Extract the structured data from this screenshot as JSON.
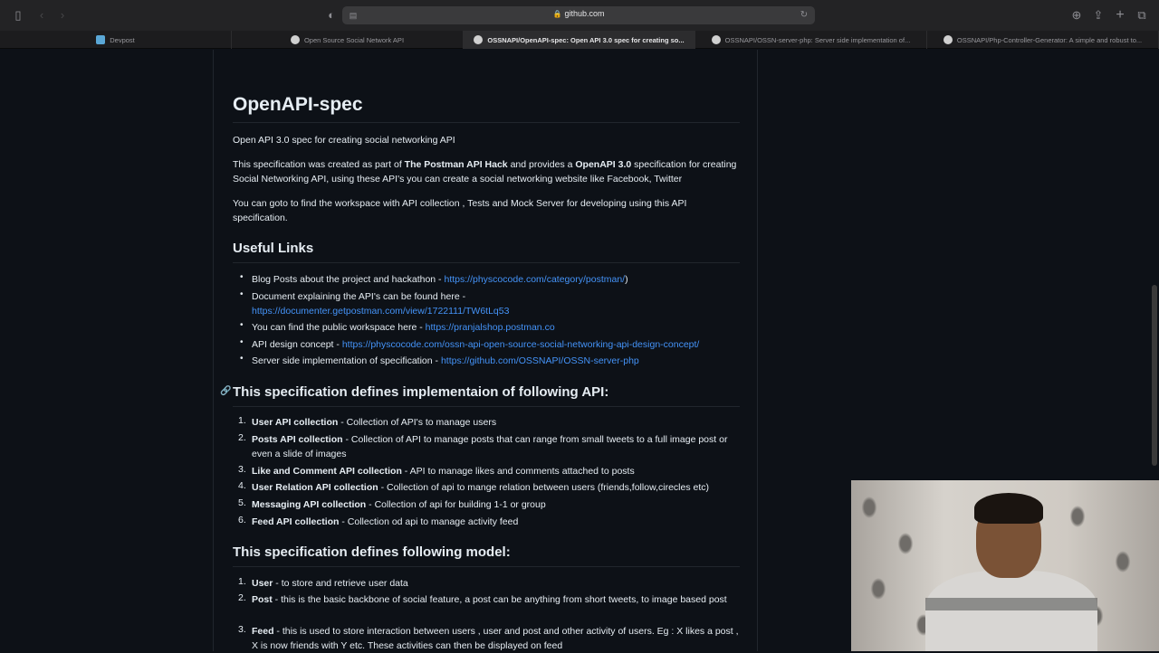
{
  "browser": {
    "url": "github.com",
    "tabs": [
      {
        "label": "Devpost",
        "icon": "devpost-icon",
        "active": false
      },
      {
        "label": "Open Source Social Network API",
        "icon": "github-icon",
        "active": false
      },
      {
        "label": "OSSNAPI/OpenAPI-spec: Open API 3.0 spec for creating so...",
        "icon": "github-icon",
        "active": true
      },
      {
        "label": "OSSNAPI/OSSN-server-php: Server side implementation of...",
        "icon": "github-icon",
        "active": false
      },
      {
        "label": "OSSNAPI/Php-Controller-Generator: A simple and robust to...",
        "icon": "github-icon",
        "active": false
      }
    ]
  },
  "readme": {
    "title": "OpenAPI-spec",
    "intro": "Open API 3.0 spec for creating social networking API",
    "para1": {
      "a": "This specification was created as part of ",
      "b": "The Postman API Hack",
      "c": " and provides a ",
      "d": "OpenAPI 3.0",
      "e": " specification for creating Social Networking API, using these API's you can create a social networking website like Facebook, Twitter"
    },
    "para2": "You can goto to find the workspace with API collection , Tests and Mock Server for developing using this API specification.",
    "useful_links_heading": "Useful Links",
    "links": [
      {
        "text": "Blog Posts about the project and hackathon - ",
        "link": "https://physcocode.com/category/postman/",
        "after": ")"
      },
      {
        "text": "Document explaining the API's can be found here - ",
        "link": "https://documenter.getpostman.com/view/1722111/TW6tLq53",
        "after": ""
      },
      {
        "text": "You can find the public workspace here - ",
        "link": "https://pranjalshop.postman.co",
        "after": ""
      },
      {
        "text": "API design concept - ",
        "link": "https://physcocode.com/ossn-api-open-source-social-networking-api-design-concept/",
        "after": ""
      },
      {
        "text": "Server side implementation of specification - ",
        "link": "https://github.com/OSSNAPI/OSSN-server-php",
        "after": ""
      }
    ],
    "impl_heading": "This specification defines implementaion of following API:",
    "apis": [
      {
        "num": "1.",
        "name": "User API collection",
        "desc": " - Collection of API's to manage users"
      },
      {
        "num": "2.",
        "name": "Posts API collection",
        "desc": " - Collection of API to manage posts that can range from small tweets to a full image post or even a slide of images"
      },
      {
        "num": "3.",
        "name": "Like and Comment API collection",
        "desc": " - API to manage likes and comments attached to posts"
      },
      {
        "num": "4.",
        "name": "User Relation API collection",
        "desc": " - Collection of api to mange relation between users (friends,follow,cirecles etc)"
      },
      {
        "num": "5.",
        "name": "Messaging API collection",
        "desc": " - Collection of api for building 1-1 or group"
      },
      {
        "num": "6.",
        "name": "Feed API collection",
        "desc": " - Collection od api to manage activity feed"
      }
    ],
    "model_heading": "This specification defines following model:",
    "models": [
      {
        "num": "1.",
        "name": "User",
        "desc": " - to store and retrieve user data"
      },
      {
        "num": "2.",
        "name": "Post",
        "desc": " - this is the basic backbone of social feature, a post can be anything from short tweets, to image based post"
      },
      {
        "num": "3.",
        "name": "Feed",
        "desc": " - this is used to store interaction between users , user and post and other activity of users. Eg : X likes a post , X is now friends with Y etc. These activities can then be displayed on feed"
      }
    ]
  }
}
